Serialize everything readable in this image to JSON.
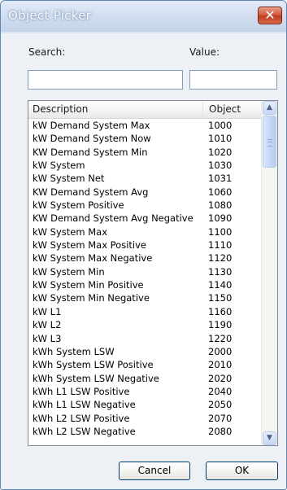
{
  "window": {
    "title": "Object Picker",
    "close_glyph": "✕"
  },
  "search": {
    "label": "Search:",
    "value": "",
    "placeholder": ""
  },
  "value_field": {
    "label": "Value:",
    "value": "",
    "placeholder": ""
  },
  "list": {
    "columns": [
      "Description",
      "Object"
    ],
    "rows": [
      [
        "kW Demand System Max",
        "1000"
      ],
      [
        "kW Demand System Now",
        "1010"
      ],
      [
        "KW Demand System Min",
        "1020"
      ],
      [
        "kW System",
        "1030"
      ],
      [
        "kW System Net",
        "1031"
      ],
      [
        "KW Demand System Avg",
        "1060"
      ],
      [
        "kW System Positive",
        "1080"
      ],
      [
        "KW Demand System Avg Negative",
        "1090"
      ],
      [
        "kW System Max",
        "1100"
      ],
      [
        "kW System Max Positive",
        "1110"
      ],
      [
        "kW System Max Negative",
        "1120"
      ],
      [
        "kW System Min",
        "1130"
      ],
      [
        "kW System Min Positive",
        "1140"
      ],
      [
        "kW System Min Negative",
        "1150"
      ],
      [
        "kW L1",
        "1160"
      ],
      [
        "kW L2",
        "1190"
      ],
      [
        "kW L3",
        "1220"
      ],
      [
        "kWh System LSW",
        "2000"
      ],
      [
        "kWh System LSW Positive",
        "2010"
      ],
      [
        "kWh System LSW Negative",
        "2020"
      ],
      [
        "kWh L1 LSW Positive",
        "2040"
      ],
      [
        "kWh L1 LSW Negative",
        "2050"
      ],
      [
        "kWh L2 LSW Positive",
        "2070"
      ],
      [
        "kWh L2 LSW Negative",
        "2080"
      ]
    ],
    "scroll_up_icon": "▲",
    "scroll_down_icon": "▼"
  },
  "buttons": {
    "cancel": "Cancel",
    "ok": "OK"
  }
}
